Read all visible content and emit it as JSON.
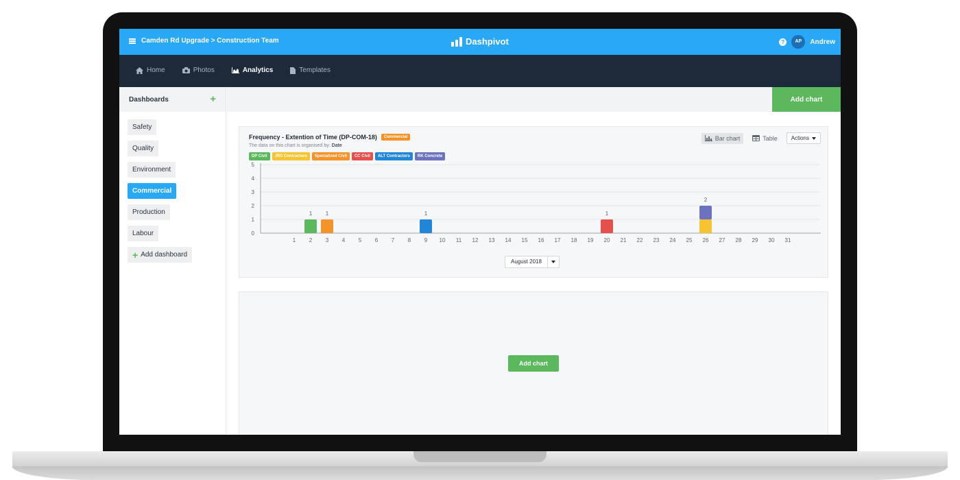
{
  "topbar": {
    "breadcrumb": "Camden Rd Upgrade > Construction Team",
    "brand": "Dashpivot",
    "avatar_initials": "AP",
    "user_name": "Andrew",
    "help_icon": "question-circle-icon"
  },
  "nav": {
    "items": [
      {
        "label": "Home",
        "icon": "home-icon"
      },
      {
        "label": "Photos",
        "icon": "camera-icon"
      },
      {
        "label": "Analytics",
        "icon": "area-chart-icon",
        "active": true
      },
      {
        "label": "Templates",
        "icon": "file-icon"
      }
    ]
  },
  "sidebar": {
    "title": "Dashboards",
    "items": [
      {
        "label": "Safety"
      },
      {
        "label": "Quality"
      },
      {
        "label": "Environment"
      },
      {
        "label": "Commercial",
        "active": true
      },
      {
        "label": "Production"
      },
      {
        "label": "Labour"
      }
    ],
    "add_label": "Add dashboard"
  },
  "toolbar": {
    "add_chart_label": "Add chart"
  },
  "chart_card": {
    "title": "Frequency - Extention of Time (DP-COM-18)",
    "tag": "Commercial",
    "tag_color": "#f6922a",
    "subtitle_prefix": "The data on this chart is organised by:",
    "subtitle_value": "Date",
    "view_bar": "Bar chart",
    "view_table": "Table",
    "actions": "Actions",
    "month": "August 2018"
  },
  "chart_data": {
    "type": "bar",
    "stacked": true,
    "categories": [
      "1",
      "2",
      "3",
      "4",
      "5",
      "6",
      "7",
      "8",
      "9",
      "10",
      "11",
      "12",
      "13",
      "14",
      "15",
      "16",
      "17",
      "18",
      "19",
      "20",
      "21",
      "22",
      "23",
      "24",
      "25",
      "26",
      "27",
      "28",
      "29",
      "30",
      "31"
    ],
    "ylim": [
      0,
      5
    ],
    "yticks": [
      0,
      1,
      2,
      3,
      4,
      5
    ],
    "grid": true,
    "series": [
      {
        "name": "DP Civil",
        "color": "#5cb85c",
        "values": [
          0,
          1,
          0,
          0,
          0,
          0,
          0,
          0,
          0,
          0,
          0,
          0,
          0,
          0,
          0,
          0,
          0,
          0,
          0,
          0,
          0,
          0,
          0,
          0,
          0,
          0,
          0,
          0,
          0,
          0,
          0
        ]
      },
      {
        "name": "JRS Contractors",
        "color": "#f7c331",
        "values": [
          0,
          0,
          0,
          0,
          0,
          0,
          0,
          0,
          0,
          0,
          0,
          0,
          0,
          0,
          0,
          0,
          0,
          0,
          0,
          0,
          0,
          0,
          0,
          0,
          0,
          1,
          0,
          0,
          0,
          0,
          0
        ]
      },
      {
        "name": "Specialized Civil",
        "color": "#f6922a",
        "values": [
          0,
          0,
          1,
          0,
          0,
          0,
          0,
          0,
          0,
          0,
          0,
          0,
          0,
          0,
          0,
          0,
          0,
          0,
          0,
          0,
          0,
          0,
          0,
          0,
          0,
          0,
          0,
          0,
          0,
          0,
          0
        ]
      },
      {
        "name": "CC Civil",
        "color": "#e5504d",
        "values": [
          0,
          0,
          0,
          0,
          0,
          0,
          0,
          0,
          0,
          0,
          0,
          0,
          0,
          0,
          0,
          0,
          0,
          0,
          0,
          1,
          0,
          0,
          0,
          0,
          0,
          0,
          0,
          0,
          0,
          0,
          0
        ]
      },
      {
        "name": "ALT Contractors",
        "color": "#2185d8",
        "values": [
          0,
          0,
          0,
          0,
          0,
          0,
          0,
          0,
          1,
          0,
          0,
          0,
          0,
          0,
          0,
          0,
          0,
          0,
          0,
          0,
          0,
          0,
          0,
          0,
          0,
          0,
          0,
          0,
          0,
          0,
          0
        ]
      },
      {
        "name": "RK Concrete",
        "color": "#6b73c1",
        "values": [
          0,
          0,
          0,
          0,
          0,
          0,
          0,
          0,
          0,
          0,
          0,
          0,
          0,
          0,
          0,
          0,
          0,
          0,
          0,
          0,
          0,
          0,
          0,
          0,
          0,
          1,
          0,
          0,
          0,
          0,
          0
        ]
      }
    ]
  },
  "empty_card": {
    "add_chart_label": "Add chart"
  }
}
